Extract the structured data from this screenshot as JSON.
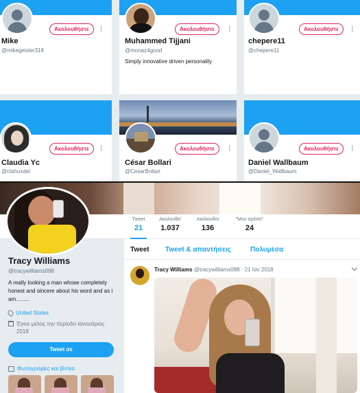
{
  "cards": [
    {
      "name": "Mike",
      "handle": "@mikegeisler318",
      "bio": "",
      "follow_label": "Ακολουθήστε",
      "avatar": "default-avatar"
    },
    {
      "name": "Muhammed Tijjani",
      "handle": "@monaz4good",
      "bio": "Simply innovative driven personality",
      "follow_label": "Ακολουθήστε",
      "avatar": "photo-avatar"
    },
    {
      "name": "chepere11",
      "handle": "@chepere11",
      "bio": "",
      "follow_label": "Ακολουθήστε",
      "avatar": "default-avatar"
    },
    {
      "name": "Claudia Yc",
      "handle": "@clahuxdel",
      "bio": "",
      "follow_label": "Ακολουθήστε",
      "avatar": "photo-avatar"
    },
    {
      "name": "César Bollari",
      "handle": "@CesarBollari",
      "bio": "",
      "follow_label": "Ακολουθήστε",
      "avatar": "photo-avatar"
    },
    {
      "name": "Daniel Wallbaum",
      "handle": "@Daniel_Wallbaum",
      "bio": "",
      "follow_label": "Ακολουθήστε",
      "avatar": "default-avatar"
    }
  ],
  "profile": {
    "name": "Tracy Williams",
    "handle": "@tracywilliams098",
    "bio": "A really looking a man whose completely honest and sincere about his word and as i am.........",
    "location": "United States",
    "joined": "Έγινε μέλος την περίοδο Ιανουάριος 2018",
    "tweet_to_label": "Tweet σε",
    "media_label": "Φωτογραφίες και βίντεο",
    "stats": [
      {
        "label": "Tweet",
        "value": "21"
      },
      {
        "label": "Ακολουθεί",
        "value": "1.037"
      },
      {
        "label": "Ακόλουθοι",
        "value": "136"
      },
      {
        "label": "\"Μου αρέσει\"",
        "value": "24"
      }
    ]
  },
  "timeline": {
    "tabs": [
      "Tweet",
      "Tweet & απαντήσεις",
      "Πολυμέσα"
    ],
    "tweet": {
      "name": "Tracy Williams",
      "handle": "@tracywilliams098",
      "date": "· 21 Ιαν 2018"
    }
  },
  "colors": {
    "accent": "#1da1f2",
    "follow": "#e0245e"
  }
}
